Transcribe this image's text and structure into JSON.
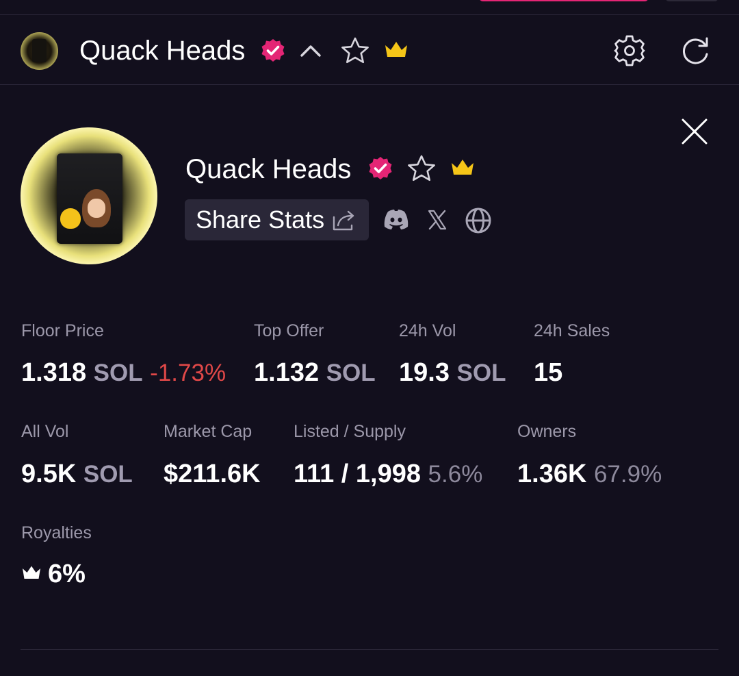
{
  "header": {
    "collection_name": "Quack Heads",
    "icons": [
      "verified-badge-icon",
      "chevron-up-icon",
      "star-icon",
      "crown-icon",
      "gear-icon",
      "refresh-icon"
    ]
  },
  "profile": {
    "collection_name": "Quack Heads",
    "share_label": "Share Stats",
    "social_icons": [
      "discord-icon",
      "x-icon",
      "globe-icon"
    ]
  },
  "stats": {
    "floor_price": {
      "label": "Floor Price",
      "value": "1.318",
      "unit": "SOL",
      "change": "-1.73%"
    },
    "top_offer": {
      "label": "Top Offer",
      "value": "1.132",
      "unit": "SOL"
    },
    "vol_24h": {
      "label": "24h Vol",
      "value": "19.3",
      "unit": "SOL"
    },
    "sales_24h": {
      "label": "24h Sales",
      "value": "15"
    },
    "all_vol": {
      "label": "All Vol",
      "value": "9.5K",
      "unit": "SOL"
    },
    "market_cap": {
      "label": "Market Cap",
      "value": "$211.6K"
    },
    "listed_supply": {
      "label": "Listed / Supply",
      "value": "111 / 1,998",
      "pct": "5.6%"
    },
    "owners": {
      "label": "Owners",
      "value": "1.36K",
      "pct": "67.9%"
    },
    "royalties": {
      "label": "Royalties",
      "value": "6%"
    }
  },
  "colors": {
    "background": "#120f1d",
    "accent_pink": "#e42575",
    "crown_gold": "#f5c518",
    "negative_red": "#e04848",
    "muted_text": "#9c98aa"
  }
}
